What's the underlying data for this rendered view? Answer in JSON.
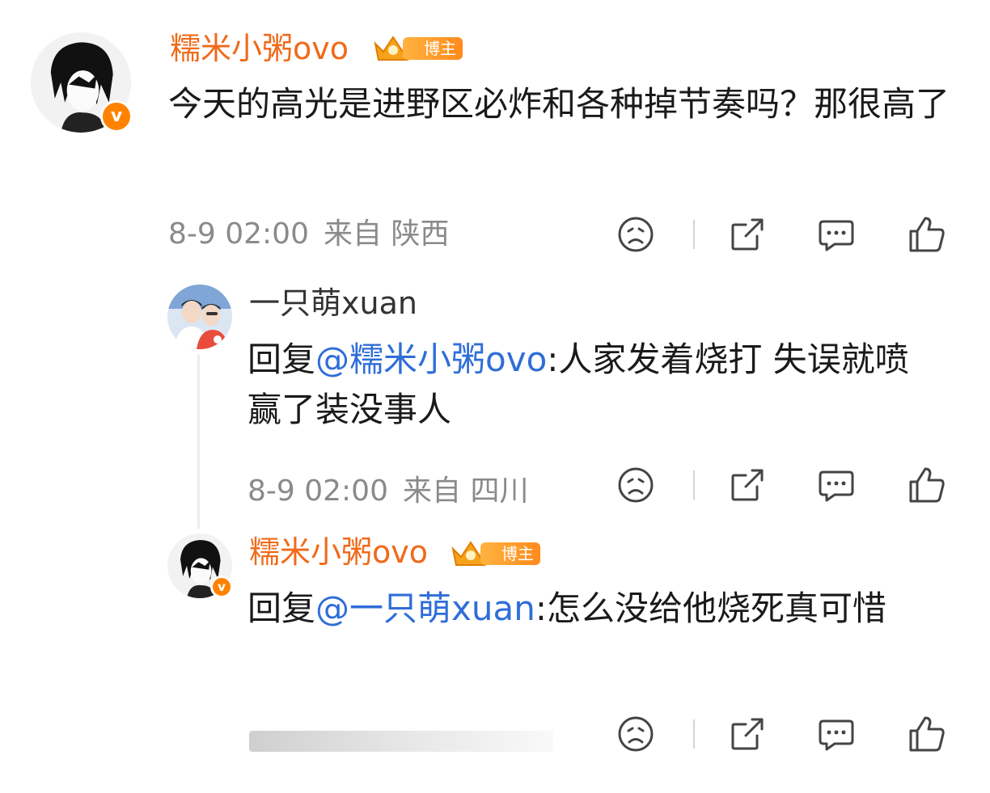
{
  "comment": {
    "username": "糯米小粥ovo",
    "badge": "博主",
    "verified_mark": "v",
    "text": "今天的高光是进野区必炸和各种掉节奏吗？那很高了",
    "date": "8-9 02:00",
    "location": "来自 陕西"
  },
  "replies": [
    {
      "username": "一只萌xuan",
      "prefix": "回复",
      "mention": "@糯米小粥ovo",
      "colon": ":",
      "text": "人家发着烧打 失误就喷 赢了装没事人",
      "date": "8-9 02:00",
      "location": "来自 四川"
    },
    {
      "username": "糯米小粥ovo",
      "badge": "博主",
      "verified_mark": "v",
      "prefix": "回复",
      "mention": "@一只萌xuan",
      "colon": ":",
      "text": "怎么没给他烧死真可惜"
    }
  ],
  "icons": [
    "dislike-icon",
    "share-icon",
    "comment-icon",
    "like-icon"
  ],
  "colors": {
    "username": "#f06a1a",
    "mention": "#2f6ed8",
    "badge": "#ff8a1c",
    "meta": "#8a8a8a"
  }
}
